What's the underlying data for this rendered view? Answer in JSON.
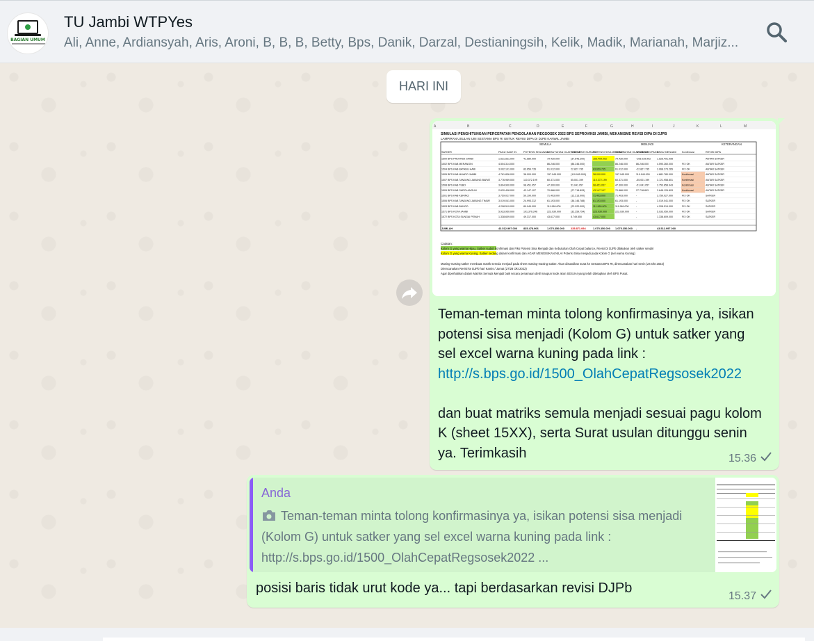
{
  "header": {
    "title": "TU Jambi WTPYes",
    "members": "Ali, Anne, Ardiansyah, Aris, Aroni, B, B, B, Betty, Bps, Danik, Darzal, Destianingsih, Kelik, Madik, Marianah, Marjiz...",
    "avatar_text": "BAGIAN UMUM",
    "search_icon": "search-icon"
  },
  "date_chip": "HARI INI",
  "messages": [
    {
      "attachment": {
        "title": "SIMULASI PENGHITUNGAN PERCEPATAN PENGOLAHAN REGSOSEK 2022 BPS SEPROVINSI JAMBI, MEKANISME REVISI DIPA DI DJPB",
        "subtitle": "LAMPIRAN USULAN UIN SESTAMA BPS RI UNTUK REVISI DIPA DI DJPB KANWIL JAMBI",
        "col_letters": [
          "A",
          "B",
          "C",
          "D",
          "E",
          "F",
          "G",
          "H",
          "I",
          "J",
          "K",
          "L",
          "M"
        ],
        "group_headers": [
          "SEMULA",
          "MENJADI",
          "KETERANGAN"
        ],
        "headers": [
          "SATKER",
          "PAGU SAAT IN",
          "POTENSI SISA AWAL",
          "KEBUTUHAN OLAH CEPAT",
          "SISA LEBIH KURANG",
          "POTENSI SISA MENJADI",
          "KEBUTUHAN OLAH CEPAT",
          "TAMBAHAN PAGU",
          "PAGU MENJADI",
          "Konfirmasi",
          "REVISI DIPA"
        ],
        "rows": [
          [
            "1500 BPS PROVINSI JAMBI",
            "1.631.531.000",
            "41.580.000",
            "79.430.000",
            "(37.843.200)",
            "166.409.002",
            "79.430.000",
            "-105.039.902",
            "1.526.491.998",
            "",
            "ANTAR SATKER"
          ],
          [
            "1502 BPS KAB MERANGIN",
            "4.504.314.000",
            "",
            "86.246.000",
            "(86.246.000)",
            "",
            "86.246.000",
            "86.246.000",
            "4.590.260.000",
            "FIX OK",
            "ANTAR SATKER"
          ],
          [
            "1504 BPS KAB BATANG HARI",
            "3.092.101.000",
            "83.659.735",
            "61.012.000",
            "22.827.735",
            "83.659.735",
            "61.012.000",
            "-22.827.735",
            "3.068.273.265",
            "FIX OK",
            "ANTAR SATKER"
          ],
          [
            "1505 BPS KAB MUARO JAMBI",
            "4.761.836.000",
            "38.000.000",
            "157.945.000",
            "(119.945.000)",
            "38.000.000",
            "157.945.000",
            "119.945.000",
            "4.881.780.000",
            "Konfirmasi",
            "ANTAR SATKER"
          ],
          [
            "1507 BPS KAB TANJUNG JABUNG BARAT",
            "3.776.969.000",
            "110.372.199",
            "60.371.000",
            "55.001.199",
            "110.372.199",
            "60.371.000",
            "-55.001.199",
            "3.721.958.801",
            "Konfirmasi",
            "ANTAR SATKER"
          ],
          [
            "1508 BPS KAB TEBO",
            "3.804.900.000",
            "98.451.057",
            "47.300.000",
            "51.041.057",
            "98.451.057",
            "47.300.000",
            "-51.041.057",
            "3.753.858.943",
            "Konfirmasi",
            "ANTAR SATKER"
          ],
          [
            "1509 BPS KAB SAROLANGUN",
            "2.620.408.000",
            "43.147.107",
            "70.866.000",
            "(27.718.893)",
            "43.147.107",
            "70.866.000",
            "27.718.893",
            "3.648.126.893",
            "Konfirmasi",
            "ANTAR SATKER"
          ],
          [
            "1501 BPS KAB KERINCI",
            "3.759.027.000",
            "59.190.000",
            "71.403.000",
            "(12.213.000)",
            "71.403.000",
            "71.403.000",
            "-",
            "3.759.027.000",
            "FIX OK",
            "SATKER"
          ],
          [
            "1506 BPS KAB TANJUNG JABUNG TIMUR",
            "3.019.041.000",
            "24.993.212",
            "61.193.000",
            "(36.146.788)",
            "61.193.000",
            "61.193.000",
            "-",
            "3.019.041.000",
            "FIX OK",
            "SATKER"
          ],
          [
            "1503 BPS KAB BUNGO",
            "4.208.519.000",
            "89.949.000",
            "111.969.000",
            "(22.020.000)",
            "111.969.000",
            "111.969.000",
            "-",
            "4.208.519.000",
            "FIX OK",
            "SATKER"
          ],
          [
            "1571 BPS KOTA JAMBI",
            "5.933.950.000",
            "191.376.246",
            "223.930.000",
            "(32.259.754)",
            "223.930.000",
            "223.930.000",
            "-",
            "5.933.950.000",
            "FIX OK",
            "SATKER"
          ],
          [
            "1572 BPS KOTA SUNGAI PENUH",
            "1.338.609.000",
            "49.317.000",
            "43.617.000",
            "5.749.550",
            "43.617.000",
            "",
            "-",
            "1.338.609.000",
            "FIX OK",
            "SATKER"
          ]
        ],
        "total": [
          "JUMLAH",
          "43.512.997.000",
          "835.478.906",
          "1.075.350.000",
          "235.871.094",
          "1.075.350.000",
          "1.075.350.000",
          "-",
          "43.512.997.000",
          "",
          ""
        ],
        "notes_label": "Catatan :",
        "note_green": "Kolom G yang warna Hijau, Satker sudah konfirmasi dan Fiks Potensi Sisa Menjadi dan Kebutuhan Olah Cepat balance, Revisi Di DJPb dilakukan oleh satker sendiri",
        "note_yellow": "Kolom G yang warna Kuning, Satker sedang dalam konfirmasi dan AGAR MENGISIKAN NILAI Potensi Sisa menjadi pada Kolom G (sel warna Kuning)",
        "note_1": "Masing-masing satker membuat matrik semula menjadi pada sheet masing-masing satker. Akan disusulkan surat ke Sestama BPS RI, direncanakan hari senin (24 Okt 2022)",
        "note_2": "Direncanakan Revisi ke DJPb hari Kamis / Jumat (27/28 Okt 2022)",
        "note_3": "Agar diperhatikan dalam Matriks Semula Menjadi baik secara penamaan detil maupun kode akun SESUAI yang telah ditetapkan oleh BPS Pusat."
      },
      "text_1": "Teman-teman minta tolong konfirmasinya ya, isikan potensi sisa menjadi (Kolom G) untuk satker yang sel excel warna kuning pada link :",
      "link": "http://s.bps.go.id/1500_OlahCepatRegsosek2022",
      "text_2": "dan buat matriks semula menjadi sesuai pagu kolom K (sheet 15XX), serta Surat usulan ditunggu senin ya. Terimkasih",
      "time": "15.36"
    },
    {
      "quote_author": "Anda",
      "quote_text": "Teman-teman minta tolong konfirmasinya ya, isikan potensi sisa menjadi (Kolom G) untuk satker yang sel excel warna kuning pada link : http://s.bps.go.id/1500_OlahCepatRegsosek2022 ...",
      "text": "posisi baris tidak urut kode ya... tapi berdasarkan revisi DJPb",
      "time": "15.37"
    }
  ],
  "colors": {
    "chat_bg": "#efeae2",
    "bubble_out": "#d9fdd3",
    "link": "#027eb5",
    "cell_green": "#92d050",
    "cell_yellow": "#ffff00"
  }
}
